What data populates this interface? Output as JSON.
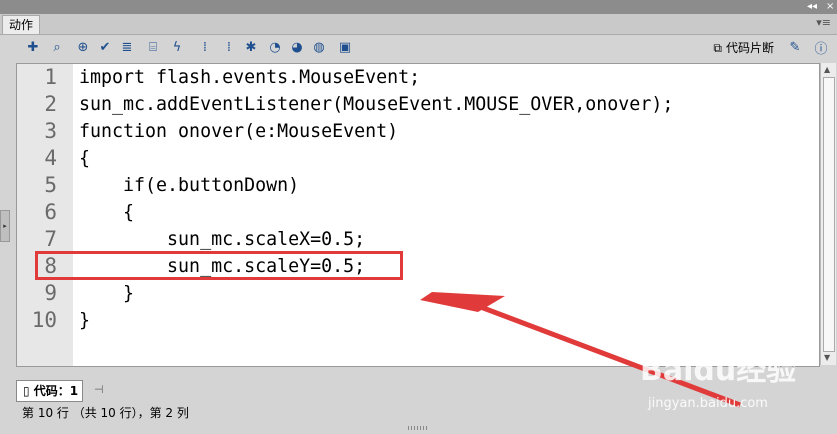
{
  "window": {
    "panel_menu_icon": "panel-menu-icon"
  },
  "tab": {
    "label": "动作"
  },
  "toolbar": {
    "icons": [
      "add-statement-icon",
      "find-icon",
      "target-icon",
      "check-syntax-icon",
      "auto-format-icon",
      "code-hint-icon",
      "debug-options-icon",
      "collapse-between-braces-icon",
      "collapse-selection-icon",
      "expand-all-icon",
      "apply-block-comment-icon",
      "apply-line-comment-icon",
      "remove-comment-icon",
      "show-hide-toolbox-icon"
    ],
    "snippets_label": "代码片断"
  },
  "editor": {
    "line_numbers": [
      "1",
      "2",
      "3",
      "4",
      "5",
      "6",
      "7",
      "8",
      "9",
      "10"
    ],
    "lines": [
      "import flash.events.MouseEvent;",
      "sun_mc.addEventListener(MouseEvent.MOUSE_OVER,onover);",
      "function onover(e:MouseEvent)",
      "{",
      "    if(e.buttonDown)",
      "    {",
      "        sun_mc.scaleX=0.5;",
      "        sun_mc.scaleY=0.5;",
      "    }",
      "}"
    ],
    "highlight_color": "#e13a3a"
  },
  "bottom_tab": {
    "label": "代码：1"
  },
  "status": {
    "text": "第 10 行 （共 10 行），第 2 列"
  },
  "watermark": {
    "brand": "Baidu经验",
    "url": "jingyan.baidu.com"
  }
}
